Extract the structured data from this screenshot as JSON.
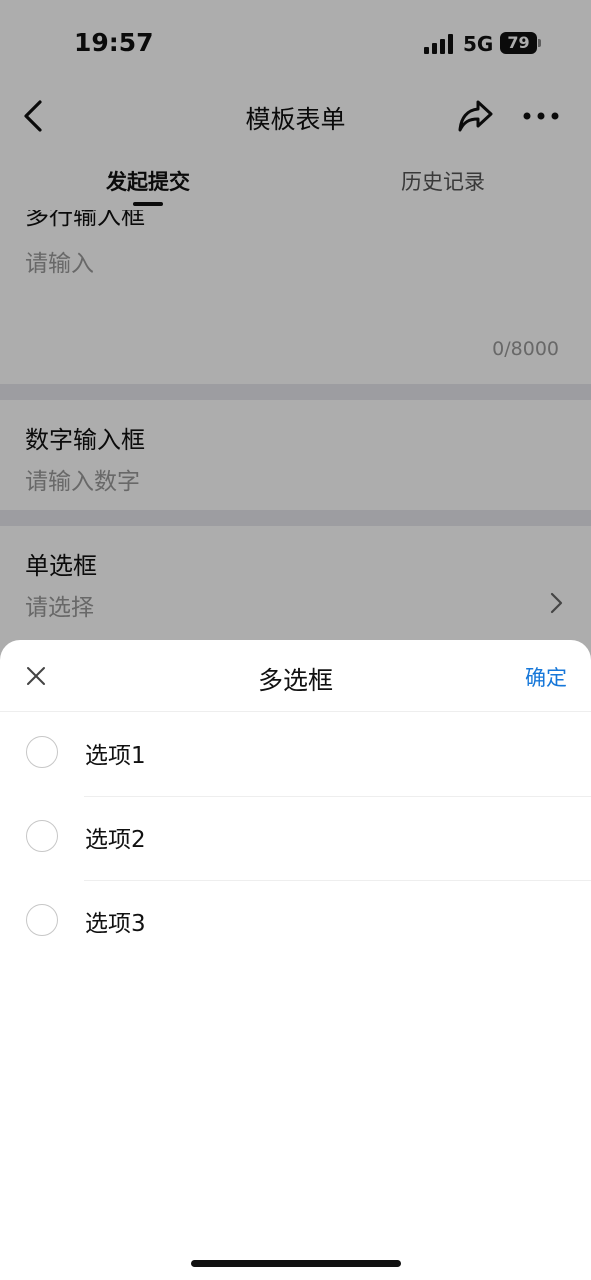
{
  "status_bar": {
    "time": "19:57",
    "network": "5G",
    "battery": "79"
  },
  "nav": {
    "title": "模板表单",
    "icons": [
      "chevron-left-icon",
      "share-icon",
      "more-icon"
    ]
  },
  "tabs": [
    {
      "label": "发起提交",
      "active": true
    },
    {
      "label": "历史记录",
      "active": false
    }
  ],
  "form": {
    "multiline_field": {
      "label": "多行输入框",
      "placeholder": "请输入",
      "counter": "0/8000"
    },
    "number_field": {
      "label": "数字输入框",
      "placeholder": "请输入数字"
    },
    "radio_field": {
      "label": "单选框",
      "placeholder": "请选择"
    }
  },
  "sheet": {
    "title": "多选框",
    "confirm_label": "确定",
    "options": [
      {
        "label": "选项1",
        "checked": false
      },
      {
        "label": "选项2",
        "checked": false
      },
      {
        "label": "选项3",
        "checked": false
      }
    ]
  },
  "colors": {
    "accent": "#1677d9",
    "overlay": "rgba(0,0,0,0.32)",
    "divider_band": "#e8e8ed"
  }
}
